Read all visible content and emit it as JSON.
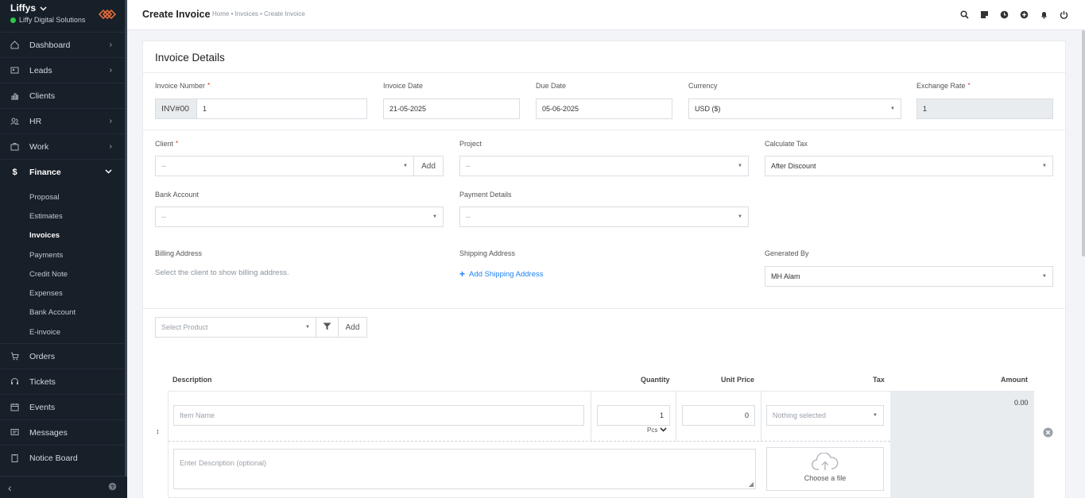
{
  "sidebar": {
    "brand": "Liffys",
    "company": "Liffy Digital Solutions",
    "items": [
      {
        "label": "Dashboard",
        "icon": "home-icon",
        "chevron": true
      },
      {
        "label": "Leads",
        "icon": "leads-icon",
        "chevron": true
      },
      {
        "label": "Clients",
        "icon": "clients-icon",
        "chevron": false
      },
      {
        "label": "HR",
        "icon": "hr-icon",
        "chevron": true
      },
      {
        "label": "Work",
        "icon": "work-icon",
        "chevron": true
      },
      {
        "label": "Finance",
        "icon": "dollar-icon",
        "chevron": true
      }
    ],
    "finance_sub": [
      "Proposal",
      "Estimates",
      "Invoices",
      "Payments",
      "Credit Note",
      "Expenses",
      "Bank Account",
      "E-invoice"
    ],
    "items_after": [
      {
        "label": "Orders",
        "icon": "cart-icon"
      },
      {
        "label": "Tickets",
        "icon": "headset-icon"
      },
      {
        "label": "Events",
        "icon": "calendar-icon"
      },
      {
        "label": "Messages",
        "icon": "message-icon"
      },
      {
        "label": "Notice Board",
        "icon": "clipboard-icon"
      }
    ]
  },
  "header": {
    "title": "Create Invoice",
    "breadcrumb": "Home • Invoices • Create Invoice"
  },
  "form": {
    "card_title": "Invoice Details",
    "invoice_number_label": "Invoice Number",
    "invoice_prefix": "INV#00",
    "invoice_number": "1",
    "invoice_date_label": "Invoice Date",
    "invoice_date": "21-05-2025",
    "due_date_label": "Due Date",
    "due_date": "05-06-2025",
    "currency_label": "Currency",
    "currency": "USD ($)",
    "exchange_rate_label": "Exchange Rate",
    "exchange_rate": "1",
    "client_label": "Client",
    "client": "--",
    "add_label": "Add",
    "project_label": "Project",
    "project": "--",
    "calc_tax_label": "Calculate Tax",
    "calc_tax": "After Discount",
    "bank_account_label": "Bank Account",
    "bank_account": "--",
    "payment_details_label": "Payment Details",
    "payment_details": "--",
    "billing_label": "Billing Address",
    "billing_hint": "Select the client to show billing address.",
    "shipping_label": "Shipping Address",
    "shipping_link": "Add Shipping Address",
    "generated_by_label": "Generated By",
    "generated_by": "MH Alam",
    "select_product": "Select Product"
  },
  "items_table": {
    "headers": [
      "Description",
      "Quantity",
      "Unit Price",
      "Tax",
      "Amount"
    ],
    "item_placeholder": "Item Name",
    "quantity": "1",
    "unit": "Pcs",
    "unit_price": "0",
    "tax": "Nothing selected",
    "amount": "0.00",
    "description_placeholder": "Enter Description (optional)",
    "upload_label": "Choose a file"
  }
}
